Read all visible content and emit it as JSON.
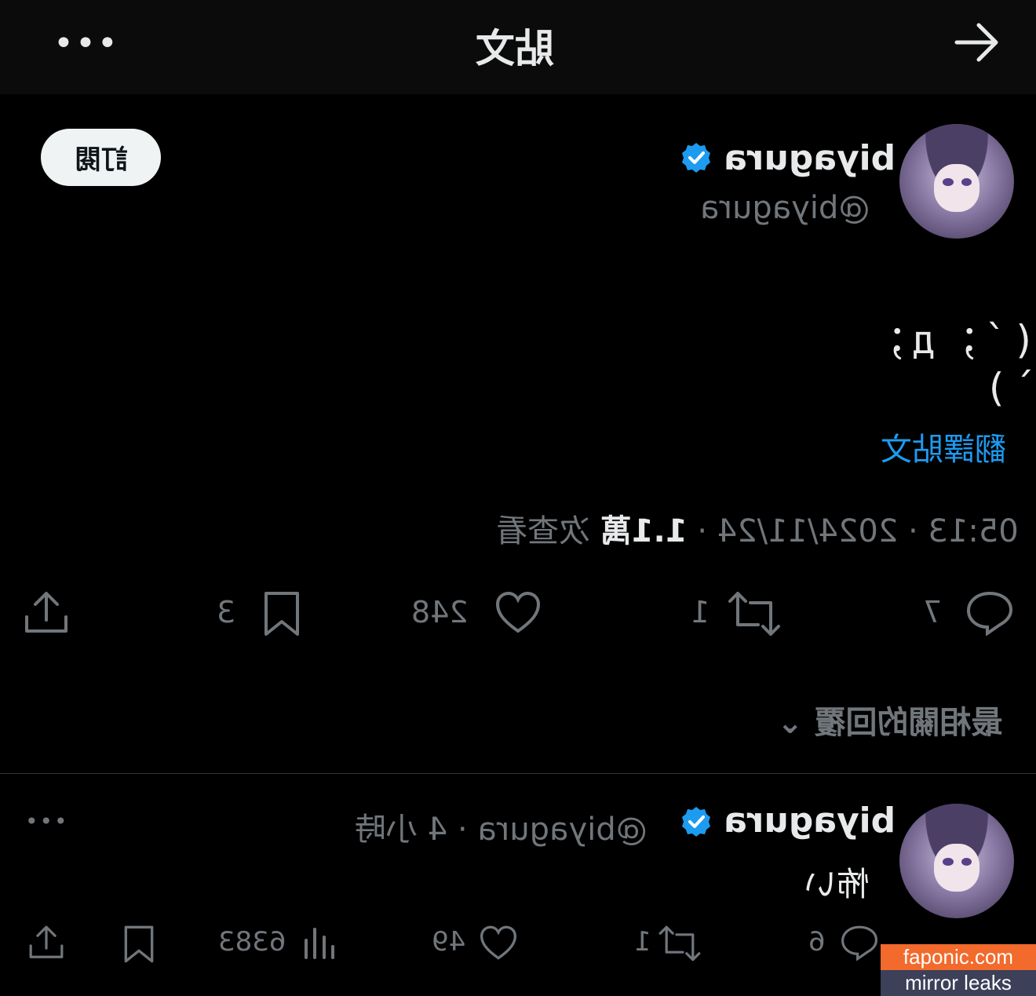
{
  "header": {
    "title": "貼文"
  },
  "post": {
    "author_name": "biyagura",
    "author_handle": "@biyagura",
    "subscribe_label": "訂閱",
    "text": "(´；д；`)",
    "translate_label": "翻譯貼文",
    "time": "05:13",
    "date": "2024/11/24",
    "views_count": "1.1萬",
    "views_label": "次查看",
    "actions": {
      "replies": "7",
      "reposts": "1",
      "likes": "248",
      "bookmarks": "3"
    }
  },
  "sort": {
    "label": "最相關的回覆"
  },
  "reply": {
    "author_name": "biyagura",
    "author_handle": "@biyagura",
    "time_ago": "4 小時",
    "text": "怖い",
    "actions": {
      "replies": "6",
      "reposts": "1",
      "likes": "49",
      "views": "6383"
    }
  },
  "watermark": {
    "line1": "faponic.com",
    "line2": "mirror leaks"
  },
  "colors": {
    "background": "#000000",
    "accent": "#1d9bf0",
    "muted": "#71767b",
    "text": "#e7e9ea"
  }
}
